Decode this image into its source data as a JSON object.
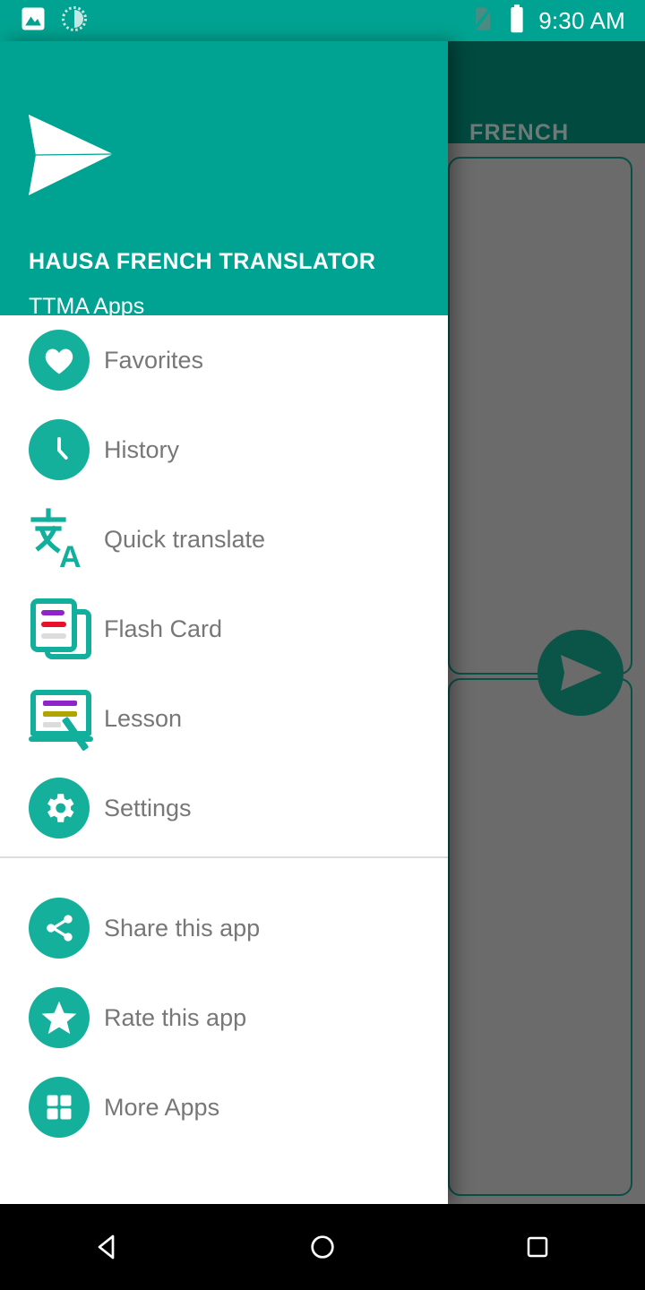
{
  "status_bar": {
    "time": "9:30 AM",
    "left_icons": [
      {
        "name": "image-icon",
        "label": "Screenshot"
      },
      {
        "name": "sync-progress-icon",
        "label": "Sync"
      }
    ],
    "right_icons": [
      {
        "name": "no-sim-icon",
        "label": "No SIM"
      },
      {
        "name": "battery-full-icon",
        "label": "Battery"
      }
    ],
    "background_color": "#00a391"
  },
  "background_app": {
    "appbar_title": "FRENCH",
    "appbar_color": "#014a40",
    "fab": {
      "name": "translate-send-fab",
      "icon": "send-icon"
    },
    "cards": [
      "source-text-card",
      "target-text-card"
    ],
    "scrim_color": "#6b6b6b"
  },
  "drawer": {
    "header": {
      "logo": "paper-plane-logo",
      "title": "HAUSA FRENCH TRANSLATOR",
      "subtitle": "TTMA Apps",
      "background_color": "#00a391"
    },
    "primary_items": [
      {
        "id": "favorites",
        "label": "Favorites",
        "icon": "heart-icon",
        "style": "circle"
      },
      {
        "id": "history",
        "label": "History",
        "icon": "clock-icon",
        "style": "circle"
      },
      {
        "id": "quick-translate",
        "label": "Quick translate",
        "icon": "translate-icon",
        "style": "plain"
      },
      {
        "id": "flash-card",
        "label": "Flash Card",
        "icon": "flash-card-icon",
        "style": "plain"
      },
      {
        "id": "lesson",
        "label": "Lesson",
        "icon": "lesson-icon",
        "style": "plain"
      },
      {
        "id": "settings",
        "label": "Settings",
        "icon": "gear-icon",
        "style": "circle"
      }
    ],
    "secondary_items": [
      {
        "id": "share-app",
        "label": "Share this app",
        "icon": "share-icon",
        "style": "circle"
      },
      {
        "id": "rate-app",
        "label": "Rate this app",
        "icon": "star-icon",
        "style": "circle"
      },
      {
        "id": "more-apps",
        "label": "More Apps",
        "icon": "grid-icon",
        "style": "circle"
      }
    ],
    "accent_color": "#15b09b",
    "label_color": "#777777"
  },
  "nav_bar": {
    "buttons": [
      {
        "id": "back",
        "icon": "back-triangle-icon"
      },
      {
        "id": "home",
        "icon": "home-circle-icon"
      },
      {
        "id": "recents",
        "icon": "recents-square-icon"
      }
    ],
    "background_color": "#000000"
  }
}
